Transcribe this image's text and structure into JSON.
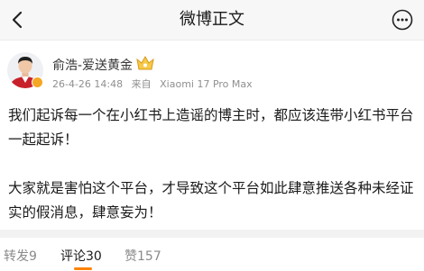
{
  "navbar": {
    "title": "微博正文",
    "back_icon": "chevron-left-icon",
    "more_icon": "more-horizontal-icon"
  },
  "author": {
    "name": "俞浩-爱送黄金",
    "date": "26-4-26 14:48",
    "source_prefix": "来自",
    "device": "Xiaomi 17 Pro Max",
    "badge_icon": "crown-vip-icon",
    "verified_icon": "verified-badge-icon"
  },
  "post": {
    "text": "我们起诉每一个在小红书上造谣的博主时，都应该连带小红书平台一起起诉！\n\n大家就是害怕这个平台，才导致这个平台如此肆意推送各种未经证实的假消息，肆意妄为！"
  },
  "tabs": {
    "repost": "转发9",
    "comment": "评论30",
    "like": "赞157",
    "active": "comment"
  },
  "colors": {
    "accent": "#ff8200",
    "verified": "#f5a623",
    "secondary_text": "#8f8f8f"
  }
}
